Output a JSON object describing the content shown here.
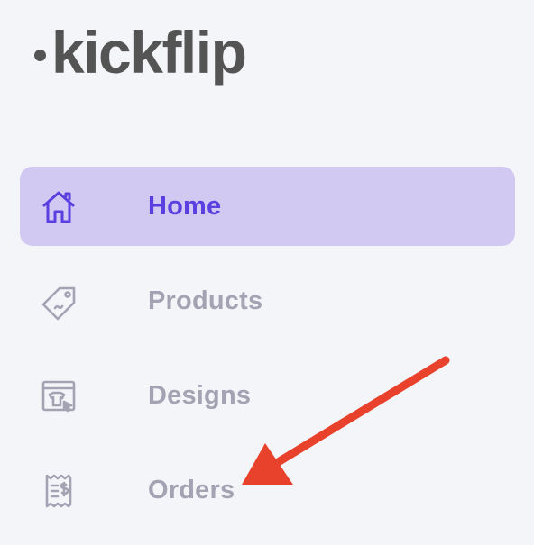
{
  "logo": {
    "text": "kickflip"
  },
  "nav": {
    "items": [
      {
        "label": "Home",
        "icon": "home-icon",
        "active": true
      },
      {
        "label": "Products",
        "icon": "tag-icon",
        "active": false
      },
      {
        "label": "Designs",
        "icon": "design-icon",
        "active": false
      },
      {
        "label": "Orders",
        "icon": "receipt-icon",
        "active": false
      }
    ]
  },
  "colors": {
    "background": "#f4f5f9",
    "active_bg": "#d2c9f3",
    "active_text": "#5b3fe0",
    "inactive_text": "#a4a3b3",
    "arrow": "#e8412c"
  }
}
